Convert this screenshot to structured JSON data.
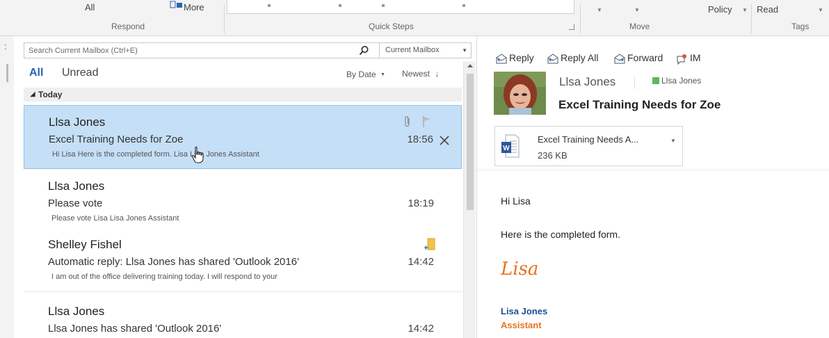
{
  "ribbon": {
    "respond_top_label": "All",
    "more_label": "More",
    "groups": {
      "respond": "Respond",
      "quick_steps": "Quick Steps",
      "move": "Move",
      "tags": "Tags"
    },
    "policy_label": "Policy",
    "read_label": "Read"
  },
  "search": {
    "placeholder": "Search Current Mailbox (Ctrl+E)",
    "scope": "Current Mailbox"
  },
  "filters": {
    "all": "All",
    "unread": "Unread",
    "sort_by": "By Date",
    "sort_order": "Newest"
  },
  "group": {
    "label": "Today"
  },
  "messages": [
    {
      "sender": "Llsa Jones",
      "subject": "Excel Training Needs for Zoe",
      "preview": "Hi Lisa  Here is the completed form.  Lisa  Lisa Jones  Assistant",
      "time": "18:56",
      "selected": true,
      "has_attachment": true
    },
    {
      "sender": "Llsa Jones",
      "subject": "Please vote",
      "preview": "Please vote  Lisa  Lisa Jones  Assistant",
      "time": "18:19",
      "selected": false
    },
    {
      "sender": "Shelley Fishel",
      "subject": "Automatic reply: Llsa Jones has shared 'Outlook 2016'",
      "preview": "I am out of the office delivering training today.  I will respond to your",
      "time": "14:42",
      "selected": false
    },
    {
      "sender": "Llsa Jones",
      "subject": "Llsa Jones has shared 'Outlook 2016'",
      "preview": "",
      "time": "14:42",
      "selected": false
    }
  ],
  "reading": {
    "actions": {
      "reply": "Reply",
      "reply_all": "Reply All",
      "forward": "Forward",
      "im": "IM"
    },
    "from": "Llsa Jones",
    "to": "Llsa Jones",
    "subject": "Excel Training Needs for Zoe",
    "attachment": {
      "name": "Excel Training Needs A...",
      "size": "236 KB"
    },
    "body": {
      "greeting": "Hi Lisa",
      "line1": "Here is the completed form.",
      "signature_script": "Lisa",
      "sig_name": "Lisa Jones",
      "sig_role": "Assistant"
    }
  },
  "colors": {
    "accent": "#2a62b8",
    "selection": "#c5dff6",
    "signature_orange": "#e8731f",
    "sig_blue": "#1f4e96",
    "presence": "#5cb85c"
  }
}
